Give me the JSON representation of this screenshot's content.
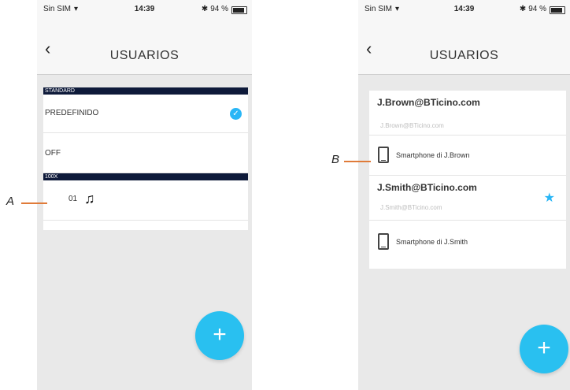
{
  "status_bar": {
    "carrier": "Sin SIM",
    "time": "14:39",
    "battery": "94 %"
  },
  "left_screen": {
    "title": "USUARIOS",
    "section1_header": "STANDARD",
    "row_predefinido": "PREDEFINIDO",
    "row_off": "OFF",
    "section2_header": "100X",
    "row_melody_number": "01",
    "fab_label": "+"
  },
  "right_screen": {
    "title": "USUARIOS",
    "users": [
      {
        "email": "J.Brown@BTicino.com",
        "sub": "J.Brown@BTicino.com",
        "device": "Smartphone di J.Brown",
        "favorite": false
      },
      {
        "email": "J.Smith@BTicino.com",
        "sub": "J.Smith@BTicino.com",
        "device": "Smartphone di J.Smith",
        "favorite": true
      }
    ],
    "fab_label": "+"
  },
  "callouts": {
    "a": "A",
    "b": "B"
  },
  "colors": {
    "accent": "#29b6f6",
    "header_dark": "#0e1a3a",
    "callout_line": "#e07b39"
  }
}
